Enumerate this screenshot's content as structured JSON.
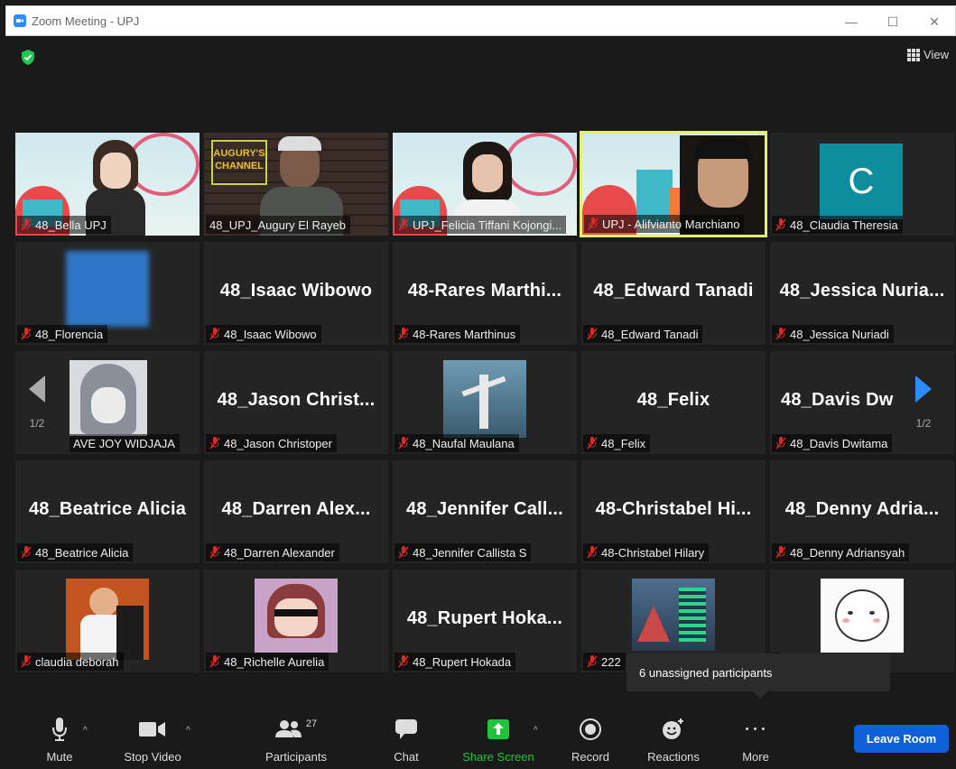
{
  "window": {
    "title": "Zoom Meeting - UPJ",
    "controls": [
      "—",
      "☐",
      "✕"
    ]
  },
  "header": {
    "view_label": "View"
  },
  "pager": {
    "left_page": "1/2",
    "right_page": "1/2"
  },
  "tiles": [
    {
      "label": "48_Bella UPJ",
      "big": ""
    },
    {
      "label": "48_UPJ_Augury El Rayeb",
      "big": ""
    },
    {
      "label": "UPJ_Felicia Tiffani Kojongi...",
      "big": ""
    },
    {
      "label": "UPJ - Alifvianto Marchiano",
      "big": ""
    },
    {
      "label": "48_Claudia Theresia",
      "big": "",
      "avatar_letter": "C",
      "avatar_color": "#0e8d9e"
    },
    {
      "label": "48_Florencia",
      "big": ""
    },
    {
      "label": "48_Isaac Wibowo",
      "big": "48_Isaac Wibowo"
    },
    {
      "label": "48-Rares Marthinus",
      "big": "48-Rares Marthi..."
    },
    {
      "label": "48_Edward Tanadi",
      "big": "48_Edward Tanadi"
    },
    {
      "label": "48_Jessica Nuriadi",
      "big": "48_Jessica Nuria..."
    },
    {
      "label": "AVE JOY WIDJAJA",
      "big": ""
    },
    {
      "label": "48_Jason Christoper",
      "big": "48_Jason Christ..."
    },
    {
      "label": "48_Naufal Maulana",
      "big": ""
    },
    {
      "label": "48_Felix",
      "big": "48_Felix"
    },
    {
      "label": "48_Davis Dwitama",
      "big": "48_Davis Dw"
    },
    {
      "label": "48_Beatrice Alicia",
      "big": "48_Beatrice Alicia"
    },
    {
      "label": "48_Darren Alexander",
      "big": "48_Darren Alex..."
    },
    {
      "label": "48_Jennifer Callista S",
      "big": "48_Jennifer Call..."
    },
    {
      "label": "48-Christabel Hilary",
      "big": "48-Christabel Hi..."
    },
    {
      "label": "48_Denny Adriansyah",
      "big": "48_Denny Adria..."
    },
    {
      "label": "claudia deborah",
      "big": ""
    },
    {
      "label": "48_Richelle Aurelia",
      "big": ""
    },
    {
      "label": "48_Rupert Hokada",
      "big": "48_Rupert Hoka..."
    },
    {
      "label": "222",
      "big": ""
    },
    {
      "label": "",
      "big": ""
    }
  ],
  "tooltip": {
    "text": "6 unassigned participants"
  },
  "toolbar": {
    "mute": "Mute",
    "stop_video": "Stop Video",
    "participants": "Participants",
    "participants_count": "27",
    "chat": "Chat",
    "share_screen": "Share Screen",
    "record": "Record",
    "reactions": "Reactions",
    "more": "More",
    "more_icon": "• • •",
    "leave": "Leave Room",
    "caret": "^"
  },
  "colors": {
    "share_green": "#21c33b",
    "leave_blue": "#0e5fd8",
    "active_border": "#e6ee74",
    "mic_red": "#e02828"
  }
}
